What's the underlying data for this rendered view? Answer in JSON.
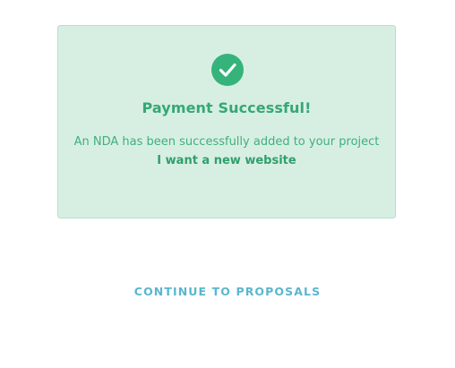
{
  "payment": {
    "title": "Payment Successful!",
    "message": "An NDA has been successfully added to your project",
    "project_name": "I want a new website",
    "icon": "check-circle-icon",
    "icon_color": "#35b37a",
    "card_background": "#d7efe3"
  },
  "actions": {
    "continue_label": "CONTINUE TO PROPOSALS",
    "continue_color": "#5bb6cf"
  }
}
